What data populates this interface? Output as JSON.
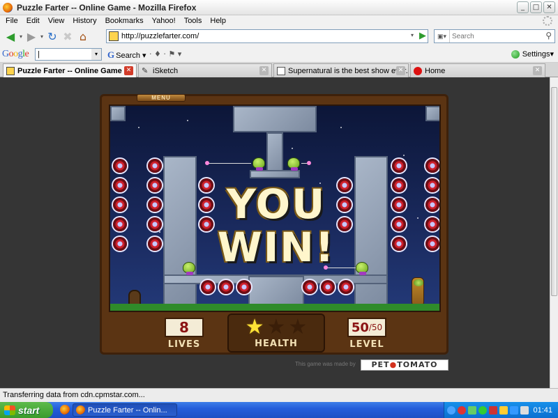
{
  "window": {
    "title": "Puzzle Farter -- Online Game - Mozilla Firefox",
    "buttons": {
      "minimize": "_",
      "maximize": "□",
      "close": "✕"
    }
  },
  "menu": [
    "File",
    "Edit",
    "View",
    "History",
    "Bookmarks",
    "Yahoo!",
    "Tools",
    "Help"
  ],
  "nav": {
    "url": "http://puzzlefarter.com/",
    "search_placeholder": "Search"
  },
  "google_toolbar": {
    "logo_letters": [
      "G",
      "o",
      "o",
      "g",
      "l",
      "e"
    ],
    "field_value": "|",
    "search_label": "Search",
    "settings_label": "Settings"
  },
  "tabs": [
    {
      "label": "Puzzle Farter -- Online Game",
      "active": true
    },
    {
      "label": "iSketch",
      "active": false
    },
    {
      "label": "Supernatural is the best show ever. - ...",
      "active": false
    },
    {
      "label": "Home",
      "active": false
    }
  ],
  "game": {
    "menu_label": "MENU",
    "win_line1": "YOU",
    "win_line2": "WIN!",
    "lives_value": "8",
    "lives_label": "LIVES",
    "health_label": "HEALTH",
    "health_stars_filled": 1,
    "health_stars_total": 3,
    "level_current": "50",
    "level_total": "/50",
    "level_label": "LEVEL",
    "credit": "This game was made by",
    "studio_part1": "PET",
    "studio_dot": "●",
    "studio_part2": "TOMATO"
  },
  "status_text": "Transferring data from cdn.cpmstar.com...",
  "taskbar": {
    "start_label": "start",
    "task_label": "Puzzle Farter -- Onlin...",
    "clock": "01:41"
  },
  "colors": {
    "game_frame": "#5b3413",
    "sky": "#1a2a5e",
    "win_text": "#fff6cc",
    "star_on": "#ffe236",
    "taskbar": "#245edb"
  }
}
